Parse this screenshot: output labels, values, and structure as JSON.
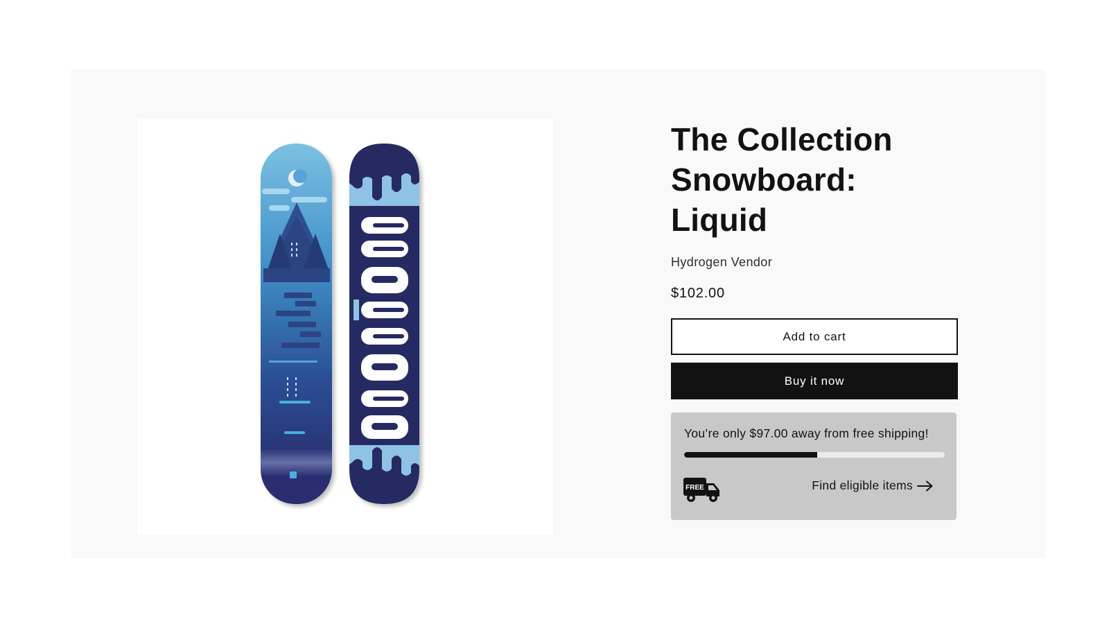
{
  "product": {
    "title": "The Collection Snowboard: Liquid",
    "vendor": "Hydrogen Vendor",
    "price": "$102.00",
    "image_alt": "Two snowboards, light and dark blue graphic with trees and 'liquid' lettering"
  },
  "actions": {
    "add_to_cart": "Add to cart",
    "buy_now": "Buy it now"
  },
  "shipping": {
    "message": "You’re only $97.00 away from free shipping!",
    "progress_percent": 51,
    "badge_text": "FREE",
    "link_label": "Find eligible items",
    "icon": "arrow-right-icon"
  },
  "colors": {
    "primary": "#121212",
    "panel_bg": "#f9f9f9",
    "shipping_bg": "#c9c8c9",
    "board_light": "#6fb0d6",
    "board_dark": "#252a63"
  }
}
